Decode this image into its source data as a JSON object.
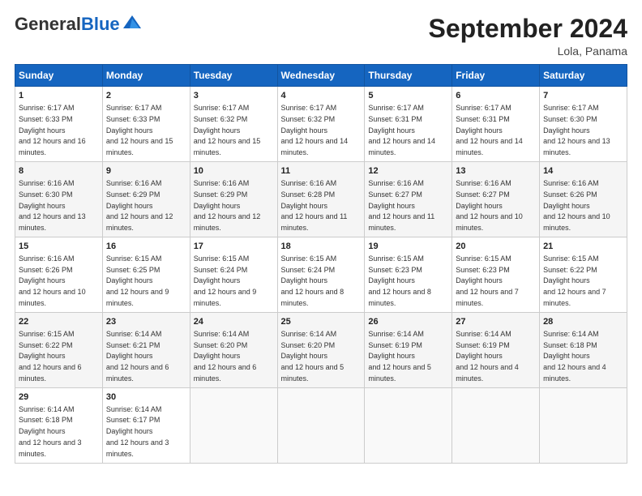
{
  "header": {
    "logo_general": "General",
    "logo_blue": "Blue",
    "month_title": "September 2024",
    "subtitle": "Lola, Panama"
  },
  "days_of_week": [
    "Sunday",
    "Monday",
    "Tuesday",
    "Wednesday",
    "Thursday",
    "Friday",
    "Saturday"
  ],
  "weeks": [
    [
      {
        "day": "1",
        "sunrise": "6:17 AM",
        "sunset": "6:33 PM",
        "daylight": "12 hours and 16 minutes."
      },
      {
        "day": "2",
        "sunrise": "6:17 AM",
        "sunset": "6:33 PM",
        "daylight": "12 hours and 15 minutes."
      },
      {
        "day": "3",
        "sunrise": "6:17 AM",
        "sunset": "6:32 PM",
        "daylight": "12 hours and 15 minutes."
      },
      {
        "day": "4",
        "sunrise": "6:17 AM",
        "sunset": "6:32 PM",
        "daylight": "12 hours and 14 minutes."
      },
      {
        "day": "5",
        "sunrise": "6:17 AM",
        "sunset": "6:31 PM",
        "daylight": "12 hours and 14 minutes."
      },
      {
        "day": "6",
        "sunrise": "6:17 AM",
        "sunset": "6:31 PM",
        "daylight": "12 hours and 14 minutes."
      },
      {
        "day": "7",
        "sunrise": "6:17 AM",
        "sunset": "6:30 PM",
        "daylight": "12 hours and 13 minutes."
      }
    ],
    [
      {
        "day": "8",
        "sunrise": "6:16 AM",
        "sunset": "6:30 PM",
        "daylight": "12 hours and 13 minutes."
      },
      {
        "day": "9",
        "sunrise": "6:16 AM",
        "sunset": "6:29 PM",
        "daylight": "12 hours and 12 minutes."
      },
      {
        "day": "10",
        "sunrise": "6:16 AM",
        "sunset": "6:29 PM",
        "daylight": "12 hours and 12 minutes."
      },
      {
        "day": "11",
        "sunrise": "6:16 AM",
        "sunset": "6:28 PM",
        "daylight": "12 hours and 11 minutes."
      },
      {
        "day": "12",
        "sunrise": "6:16 AM",
        "sunset": "6:27 PM",
        "daylight": "12 hours and 11 minutes."
      },
      {
        "day": "13",
        "sunrise": "6:16 AM",
        "sunset": "6:27 PM",
        "daylight": "12 hours and 10 minutes."
      },
      {
        "day": "14",
        "sunrise": "6:16 AM",
        "sunset": "6:26 PM",
        "daylight": "12 hours and 10 minutes."
      }
    ],
    [
      {
        "day": "15",
        "sunrise": "6:16 AM",
        "sunset": "6:26 PM",
        "daylight": "12 hours and 10 minutes."
      },
      {
        "day": "16",
        "sunrise": "6:15 AM",
        "sunset": "6:25 PM",
        "daylight": "12 hours and 9 minutes."
      },
      {
        "day": "17",
        "sunrise": "6:15 AM",
        "sunset": "6:24 PM",
        "daylight": "12 hours and 9 minutes."
      },
      {
        "day": "18",
        "sunrise": "6:15 AM",
        "sunset": "6:24 PM",
        "daylight": "12 hours and 8 minutes."
      },
      {
        "day": "19",
        "sunrise": "6:15 AM",
        "sunset": "6:23 PM",
        "daylight": "12 hours and 8 minutes."
      },
      {
        "day": "20",
        "sunrise": "6:15 AM",
        "sunset": "6:23 PM",
        "daylight": "12 hours and 7 minutes."
      },
      {
        "day": "21",
        "sunrise": "6:15 AM",
        "sunset": "6:22 PM",
        "daylight": "12 hours and 7 minutes."
      }
    ],
    [
      {
        "day": "22",
        "sunrise": "6:15 AM",
        "sunset": "6:22 PM",
        "daylight": "12 hours and 6 minutes."
      },
      {
        "day": "23",
        "sunrise": "6:14 AM",
        "sunset": "6:21 PM",
        "daylight": "12 hours and 6 minutes."
      },
      {
        "day": "24",
        "sunrise": "6:14 AM",
        "sunset": "6:20 PM",
        "daylight": "12 hours and 6 minutes."
      },
      {
        "day": "25",
        "sunrise": "6:14 AM",
        "sunset": "6:20 PM",
        "daylight": "12 hours and 5 minutes."
      },
      {
        "day": "26",
        "sunrise": "6:14 AM",
        "sunset": "6:19 PM",
        "daylight": "12 hours and 5 minutes."
      },
      {
        "day": "27",
        "sunrise": "6:14 AM",
        "sunset": "6:19 PM",
        "daylight": "12 hours and 4 minutes."
      },
      {
        "day": "28",
        "sunrise": "6:14 AM",
        "sunset": "6:18 PM",
        "daylight": "12 hours and 4 minutes."
      }
    ],
    [
      {
        "day": "29",
        "sunrise": "6:14 AM",
        "sunset": "6:18 PM",
        "daylight": "12 hours and 3 minutes."
      },
      {
        "day": "30",
        "sunrise": "6:14 AM",
        "sunset": "6:17 PM",
        "daylight": "12 hours and 3 minutes."
      },
      null,
      null,
      null,
      null,
      null
    ]
  ]
}
